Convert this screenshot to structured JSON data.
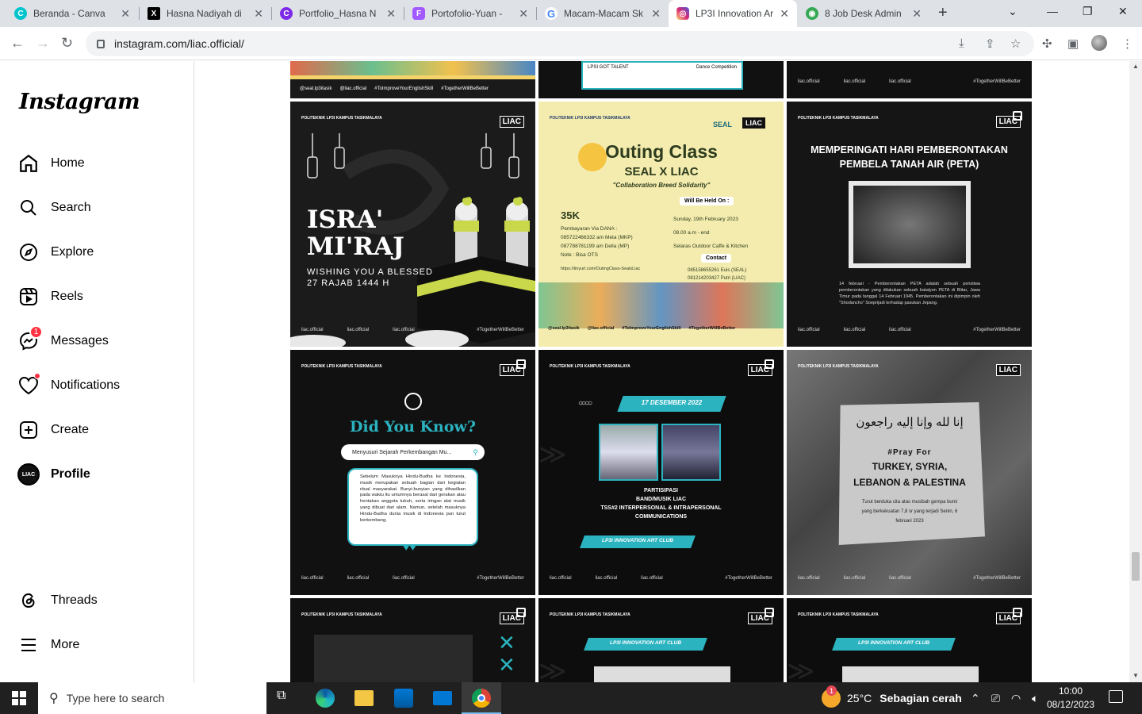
{
  "browser": {
    "tabs": [
      {
        "label": "Beranda - Canva",
        "icon": "canva-icon",
        "color": "#00c4cc"
      },
      {
        "label": "Hasna Nadiyah di",
        "icon": "x-icon",
        "color": "#000000"
      },
      {
        "label": "Portfolio_Hasna N",
        "icon": "canva-icon",
        "color": "#7d2ae8"
      },
      {
        "label": "Portofolio-Yuan - ",
        "icon": "figma-icon",
        "color": "#a259ff"
      },
      {
        "label": "Macam-Macam Sk",
        "icon": "google-icon",
        "color": "#4285f4"
      },
      {
        "label": "LP3I Innovation Ar",
        "icon": "instagram-icon",
        "color": "#e1306c"
      },
      {
        "label": "8 Job Desk Admin ",
        "icon": "android-icon",
        "color": "#34a853"
      }
    ],
    "url": "instagram.com/liac.official/"
  },
  "sidebar": {
    "logo": "Instagram",
    "items": [
      {
        "label": "Home"
      },
      {
        "label": "Search"
      },
      {
        "label": "Explore"
      },
      {
        "label": "Reels"
      },
      {
        "label": "Messages",
        "badge": "1"
      },
      {
        "label": "Notifications"
      },
      {
        "label": "Create"
      },
      {
        "label": "Profile"
      }
    ],
    "bottom": [
      {
        "label": "Threads"
      },
      {
        "label": "More"
      }
    ],
    "profile_avatar_text": "LIAC"
  },
  "posts": {
    "top": {
      "p1_tags": [
        "@seal.lp3itasik",
        "@liac.official",
        "#ToImproveYourEnglishSkill",
        "#TogetherWillBeBetter"
      ],
      "p2_lines": [
        "LPSI GOT TALENT",
        "Dance Competition"
      ],
      "p3_tags": [
        "liac.official",
        "liac.official",
        "liac.official",
        "#TogetherWillBeBetter"
      ]
    },
    "isra": {
      "header": "POLITEKNIK LP3I KAMPUS TASIKMALAYA",
      "club": "LIAC",
      "title1": "ISRA'",
      "title2": "MI'RAJ",
      "sub1": "WISHING YOU A BLESSED",
      "sub2": "27 RAJAB 1444 H",
      "footer": [
        "liac.official",
        "liac.official",
        "liac.official",
        "#TogetherWillBeBetter"
      ]
    },
    "outing": {
      "header": "POLITEKNIK LP3I KAMPUS TASIKMALAYA",
      "seal": "SEAL",
      "club": "LIAC",
      "title": "Outing Class",
      "subtitle": "SEAL X LIAC",
      "tagline": "\"Collaboration Breed Solidarity\"",
      "held": "Will Be Held On :",
      "price": "35K",
      "pay1": "Pembayaran Via DANA :",
      "pay2": "085722466332  a/n Meta (MKP)",
      "pay3": "087788781199  a/n Della (MP)",
      "pay4": "Note : Bisa OTS",
      "date": "Sunday, 19th February 2023",
      "time": "08.00 a.m - end",
      "place": "Selaras Outdoor Caffe & Kitchen",
      "contact": "Contact",
      "c1": "085158655261 Euis  (SEAL)",
      "c2": "081214203427  Putri (LIAC)",
      "link": "https://tinyurl.com/OutingClass-SealxLiac",
      "footer": [
        "@seal.lp3itasik",
        "@liac.official",
        "#ToImproveYourEnglishSkill",
        "#TogetherWillBeBetter"
      ]
    },
    "peta": {
      "header": "POLITEKNIK LP3I KAMPUS TASIKMALAYA",
      "club": "LIAC",
      "title": "MEMPERINGATI HARI PEMBERONTAKAN PEMBELA TANAH AIR (PETA)",
      "body": "14 februari - Pemberontakan PETA adalah sebuah peristiwa pemberontakan yang dilakukan sebuah batalyon PETA di Blitar, Jawa Timur pada tanggal 14 Februari 1945. Pemberontakan ini dipimpin oleh \"Shodancho\" Soeprijadi terhadap pasukan Jepang.",
      "footer": [
        "liac.official",
        "liac.official",
        "liac.official",
        "#TogetherWillBeBetter"
      ]
    },
    "didyouknow": {
      "header": "POLITEKNIK LP3I KAMPUS TASIKMALAYA",
      "club": "LIAC",
      "title": "Did You Know?",
      "search": "Menyusuri Sejarah Perkembangan Mu...",
      "body": "Sebelum Masuknya Hindu-Budha ke Indonesia, musik merupakan sebuah bagian dari kegiatan ritual masyarakat. Bunyi-bunyian yang dihasilkan pada waktu itu umumnya berasal dari gerakan atau hentakan anggota tubuh, serta iringan alat musik yang dibuat dari alam. Namun, setelah masuknya Hindu-Budha dunia musik di Indonesia pun turut berkembang.",
      "footer": [
        "liac.official",
        "liac.official",
        "liac.official",
        "#TogetherWillBeBetter"
      ]
    },
    "tss": {
      "header": "POLITEKNIK LP3I KAMPUS TASIKMALAYA",
      "club": "LIAC",
      "date": "17 DESEMBER 2022",
      "l1": "PARTISIPASI",
      "l2": "BAND/MUSIK LIAC",
      "l3": "TSS#2 INTERPERSONAL & INTRAPERSONAL",
      "l4": "COMMUNICATIONS",
      "banner": "LP3I INNOVATION ART CLUB",
      "footer": [
        "liac.official",
        "liac.official",
        "liac.official",
        "#TogetherWillBeBetter"
      ]
    },
    "pray": {
      "header": "POLITEKNIK LP3I KAMPUS TASIKMALAYA",
      "club": "LIAC",
      "arabic": "إنا لله وإنا إليه راجعون",
      "l1": "#Pray For",
      "l2": "TURKEY, SYRIA,",
      "l3": "LEBANON & PALESTINA",
      "body": "Turut berduka cita atas musibah gempa bumi yang berkekuatan 7,8 sr yang terjadi Senin, 6 februari 2023",
      "footer": [
        "liac.official",
        "liac.official",
        "liac.official",
        "#TogetherWillBeBetter"
      ]
    },
    "bottom": {
      "header": "POLITEKNIK LP3I KAMPUS TASIKMALAYA",
      "club": "LIAC",
      "banner": "LP3I INNOVATION ART CLUB"
    }
  },
  "taskbar": {
    "search_placeholder": "Type here to search",
    "weather_temp": "25°C",
    "weather_desc": "Sebagian cerah",
    "weather_badge": "1",
    "time": "10:00",
    "date": "08/12/2023"
  }
}
